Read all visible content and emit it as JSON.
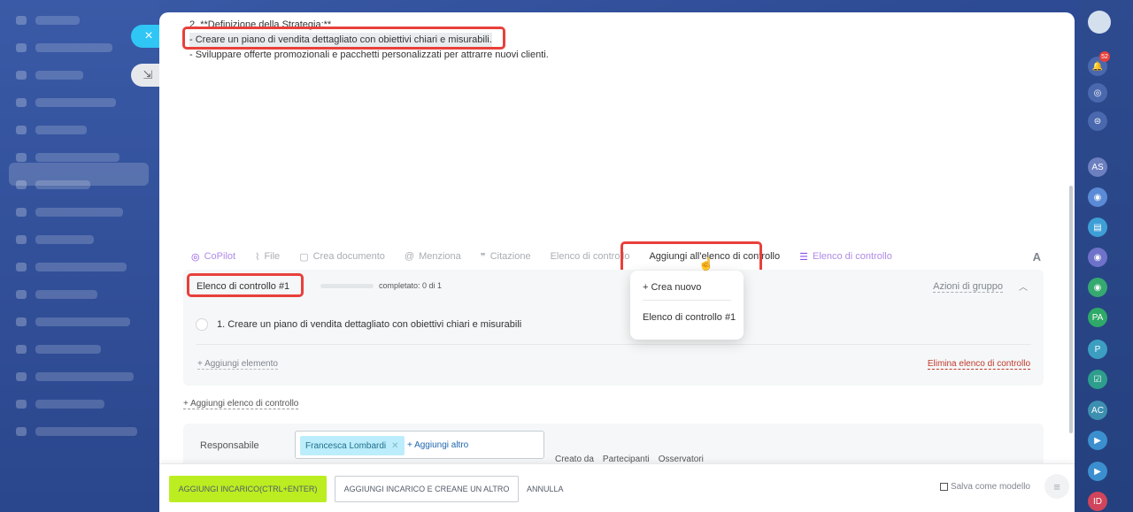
{
  "background": {
    "sidebar_rows": 16
  },
  "side_tabs": {
    "close_label": "×",
    "collapse_label": "⇲"
  },
  "editor": {
    "lines": [
      "2. **Definizione della Strategia:**",
      "- Creare un piano di vendita dettagliato con obiettivi chiari e misurabili.",
      "- Sviluppare offerte promozionali e pacchetti personalizzati per attrarre nuovi clienti."
    ]
  },
  "toolbar": {
    "copilot": "CoPilot",
    "file": "File",
    "create_doc": "Crea documento",
    "mention": "Menziona",
    "quote": "Citazione",
    "checklist": "Elenco di controllo",
    "add_to_checklist": "Aggiungi all'elenco di controllo",
    "checklist_active": "Elenco di controllo",
    "format": "A"
  },
  "dropdown": {
    "create_new": "+ Crea nuovo",
    "checklist_1": "Elenco di controllo #1"
  },
  "checklist": {
    "title": "Elenco di controllo #1",
    "progress_text": "completato: 0 di 1",
    "progress_fraction": 0,
    "group_actions": "Azioni di gruppo",
    "items": [
      "1. Creare un piano di vendita dettagliato con obiettivi chiari e misurabili"
    ],
    "add_item": "+ Aggiungi elemento",
    "delete_checklist": "Elimina elenco di controllo"
  },
  "add_checklist": "+ Aggiungi elenco di controllo",
  "responsible": {
    "label": "Responsabile",
    "person": "Francesca Lombardi",
    "add_more": "+ Aggiungi altro",
    "roles": [
      "Creato da",
      "Partecipanti",
      "Osservatori"
    ]
  },
  "footer": {
    "add_task": "AGGIUNGI INCARICO(CTRL+ENTER)",
    "add_task_and_another": "AGGIUNGI INCARICO E CREANE UN ALTRO",
    "cancel": "ANNULLA",
    "save_template": "Salva come modello"
  },
  "right_bar": {
    "notification_count": "52",
    "avatars": [
      "AS",
      "PA",
      "P",
      "AC",
      "ID"
    ]
  },
  "colors": {
    "accent_green": "#bbed21",
    "highlight_red": "#e8403b",
    "link_blue": "#2067b0",
    "copilot_purple": "#8e52ec",
    "tab_blue": "#2fc6f6"
  }
}
